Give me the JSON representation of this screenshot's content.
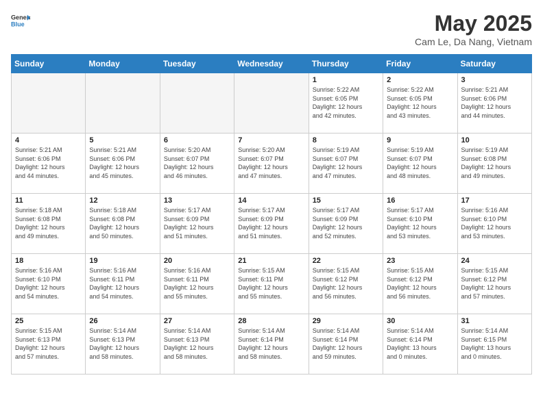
{
  "header": {
    "logo_general": "General",
    "logo_blue": "Blue",
    "month_year": "May 2025",
    "location": "Cam Le, Da Nang, Vietnam"
  },
  "days_of_week": [
    "Sunday",
    "Monday",
    "Tuesday",
    "Wednesday",
    "Thursday",
    "Friday",
    "Saturday"
  ],
  "weeks": [
    [
      {
        "day": "",
        "info": ""
      },
      {
        "day": "",
        "info": ""
      },
      {
        "day": "",
        "info": ""
      },
      {
        "day": "",
        "info": ""
      },
      {
        "day": "1",
        "info": "Sunrise: 5:22 AM\nSunset: 6:05 PM\nDaylight: 12 hours\nand 42 minutes."
      },
      {
        "day": "2",
        "info": "Sunrise: 5:22 AM\nSunset: 6:05 PM\nDaylight: 12 hours\nand 43 minutes."
      },
      {
        "day": "3",
        "info": "Sunrise: 5:21 AM\nSunset: 6:06 PM\nDaylight: 12 hours\nand 44 minutes."
      }
    ],
    [
      {
        "day": "4",
        "info": "Sunrise: 5:21 AM\nSunset: 6:06 PM\nDaylight: 12 hours\nand 44 minutes."
      },
      {
        "day": "5",
        "info": "Sunrise: 5:21 AM\nSunset: 6:06 PM\nDaylight: 12 hours\nand 45 minutes."
      },
      {
        "day": "6",
        "info": "Sunrise: 5:20 AM\nSunset: 6:07 PM\nDaylight: 12 hours\nand 46 minutes."
      },
      {
        "day": "7",
        "info": "Sunrise: 5:20 AM\nSunset: 6:07 PM\nDaylight: 12 hours\nand 47 minutes."
      },
      {
        "day": "8",
        "info": "Sunrise: 5:19 AM\nSunset: 6:07 PM\nDaylight: 12 hours\nand 47 minutes."
      },
      {
        "day": "9",
        "info": "Sunrise: 5:19 AM\nSunset: 6:07 PM\nDaylight: 12 hours\nand 48 minutes."
      },
      {
        "day": "10",
        "info": "Sunrise: 5:19 AM\nSunset: 6:08 PM\nDaylight: 12 hours\nand 49 minutes."
      }
    ],
    [
      {
        "day": "11",
        "info": "Sunrise: 5:18 AM\nSunset: 6:08 PM\nDaylight: 12 hours\nand 49 minutes."
      },
      {
        "day": "12",
        "info": "Sunrise: 5:18 AM\nSunset: 6:08 PM\nDaylight: 12 hours\nand 50 minutes."
      },
      {
        "day": "13",
        "info": "Sunrise: 5:17 AM\nSunset: 6:09 PM\nDaylight: 12 hours\nand 51 minutes."
      },
      {
        "day": "14",
        "info": "Sunrise: 5:17 AM\nSunset: 6:09 PM\nDaylight: 12 hours\nand 51 minutes."
      },
      {
        "day": "15",
        "info": "Sunrise: 5:17 AM\nSunset: 6:09 PM\nDaylight: 12 hours\nand 52 minutes."
      },
      {
        "day": "16",
        "info": "Sunrise: 5:17 AM\nSunset: 6:10 PM\nDaylight: 12 hours\nand 53 minutes."
      },
      {
        "day": "17",
        "info": "Sunrise: 5:16 AM\nSunset: 6:10 PM\nDaylight: 12 hours\nand 53 minutes."
      }
    ],
    [
      {
        "day": "18",
        "info": "Sunrise: 5:16 AM\nSunset: 6:10 PM\nDaylight: 12 hours\nand 54 minutes."
      },
      {
        "day": "19",
        "info": "Sunrise: 5:16 AM\nSunset: 6:11 PM\nDaylight: 12 hours\nand 54 minutes."
      },
      {
        "day": "20",
        "info": "Sunrise: 5:16 AM\nSunset: 6:11 PM\nDaylight: 12 hours\nand 55 minutes."
      },
      {
        "day": "21",
        "info": "Sunrise: 5:15 AM\nSunset: 6:11 PM\nDaylight: 12 hours\nand 55 minutes."
      },
      {
        "day": "22",
        "info": "Sunrise: 5:15 AM\nSunset: 6:12 PM\nDaylight: 12 hours\nand 56 minutes."
      },
      {
        "day": "23",
        "info": "Sunrise: 5:15 AM\nSunset: 6:12 PM\nDaylight: 12 hours\nand 56 minutes."
      },
      {
        "day": "24",
        "info": "Sunrise: 5:15 AM\nSunset: 6:12 PM\nDaylight: 12 hours\nand 57 minutes."
      }
    ],
    [
      {
        "day": "25",
        "info": "Sunrise: 5:15 AM\nSunset: 6:13 PM\nDaylight: 12 hours\nand 57 minutes."
      },
      {
        "day": "26",
        "info": "Sunrise: 5:14 AM\nSunset: 6:13 PM\nDaylight: 12 hours\nand 58 minutes."
      },
      {
        "day": "27",
        "info": "Sunrise: 5:14 AM\nSunset: 6:13 PM\nDaylight: 12 hours\nand 58 minutes."
      },
      {
        "day": "28",
        "info": "Sunrise: 5:14 AM\nSunset: 6:14 PM\nDaylight: 12 hours\nand 58 minutes."
      },
      {
        "day": "29",
        "info": "Sunrise: 5:14 AM\nSunset: 6:14 PM\nDaylight: 12 hours\nand 59 minutes."
      },
      {
        "day": "30",
        "info": "Sunrise: 5:14 AM\nSunset: 6:14 PM\nDaylight: 13 hours\nand 0 minutes."
      },
      {
        "day": "31",
        "info": "Sunrise: 5:14 AM\nSunset: 6:15 PM\nDaylight: 13 hours\nand 0 minutes."
      }
    ]
  ]
}
